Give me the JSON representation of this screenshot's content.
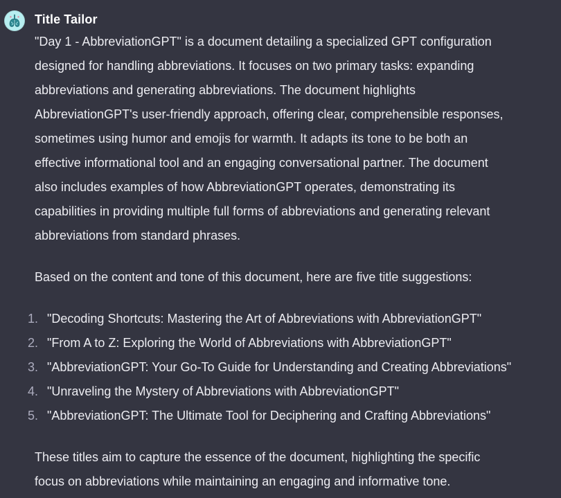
{
  "message": {
    "author": "Title Tailor",
    "avatar_icon": "brain-lungs-icon",
    "paragraph_1_lines": [
      "\"Day 1 - AbbreviationGPT\" is a document detailing a specialized GPT configuration",
      "designed for handling abbreviations. It focuses on two primary tasks: expanding",
      "abbreviations and generating abbreviations. The document highlights",
      "AbbreviationGPT's user-friendly approach, offering clear, comprehensible responses,",
      "sometimes using humor and emojis for warmth. It adapts its tone to be both an",
      "effective informational tool and an engaging conversational partner. The document",
      "also includes examples of how AbbreviationGPT operates, demonstrating its",
      "capabilities in providing multiple full forms of abbreviations and generating relevant",
      "abbreviations from standard phrases."
    ],
    "paragraph_2": "Based on the content and tone of this document, here are five title suggestions:",
    "titles": [
      {
        "number": "1.",
        "text": "\"Decoding Shortcuts: Mastering the Art of Abbreviations with AbbreviationGPT\""
      },
      {
        "number": "2.",
        "text": "\"From A to Z: Exploring the World of Abbreviations with AbbreviationGPT\""
      },
      {
        "number": "3.",
        "text": "\"AbbreviationGPT: Your Go-To Guide for Understanding and Creating Abbreviations\""
      },
      {
        "number": "4.",
        "text": "\"Unraveling the Mystery of Abbreviations with AbbreviationGPT\""
      },
      {
        "number": "5.",
        "text": "\"AbbreviationGPT: The Ultimate Tool for Deciphering and Crafting Abbreviations\""
      }
    ],
    "paragraph_3_lines": [
      "These titles aim to capture the essence of the document, highlighting the specific",
      "focus on abbreviations while maintaining an engaging and informative tone."
    ]
  },
  "colors": {
    "background": "#343541",
    "text": "#ececf1",
    "author": "#ffffff",
    "list_number": "#acacbe",
    "avatar_bg": "#b7eef0"
  }
}
